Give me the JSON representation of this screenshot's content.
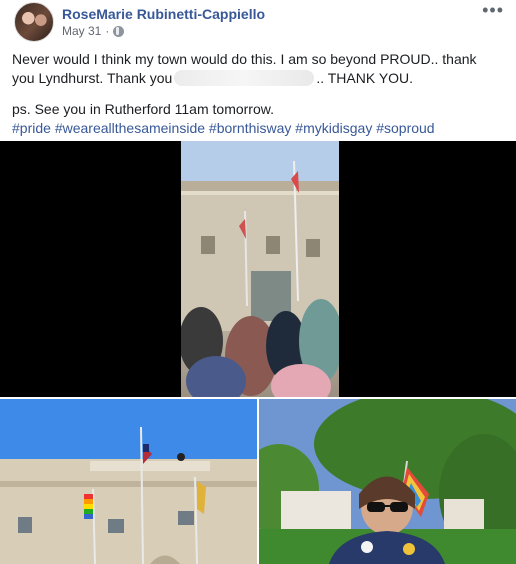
{
  "post": {
    "author": "RoseMarie Rubinetti-Cappiello",
    "date": "May 31",
    "date_separator": "·",
    "more_label": "•••",
    "privacy_icon": "globe-icon",
    "text": {
      "line1": "Never would I think my town would do this. I am so beyond PROUD.. thank",
      "line2_start": "you Lyndhurst. Thank you",
      "line2_end": ".. THANK YOU.",
      "line3": "ps. See you in Rutherford 11am tomorrow."
    },
    "hashtags": [
      "#pride",
      "#weareallthesameinside",
      "#bornthisway",
      "#mykidisgay",
      "#soproud"
    ]
  },
  "colors": {
    "link": "#385898",
    "text": "#1c1e21",
    "meta": "#616770",
    "video_background": "#000000"
  }
}
